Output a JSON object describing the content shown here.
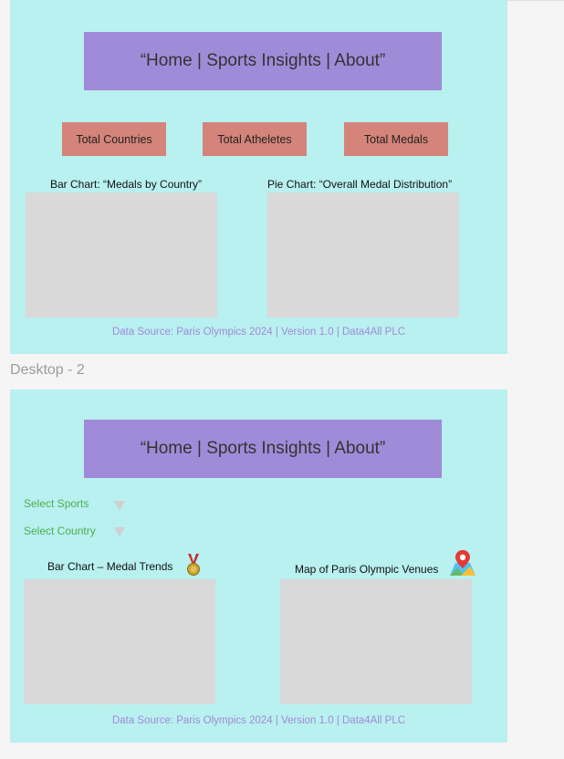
{
  "frame_label": "Desktop - 2",
  "desktop1": {
    "nav": "“Home | Sports Insights | About”",
    "cards": [
      "Total Countries",
      "Total Atheletes",
      "Total Medals"
    ],
    "bar_chart_title": "Bar Chart: “Medals by Country”",
    "pie_chart_title": "Pie Chart: “Overall Medal Distribution”",
    "footer": "Data Source: Paris Olympics 2024 | Version 1.0 | Data4All PLC"
  },
  "desktop2": {
    "nav": "“Home | Sports Insights | About”",
    "filters": {
      "sports": "Select Sports",
      "country": "Select Country"
    },
    "bar_chart_title": "Bar Chart – Medal Trends",
    "map_title": "Map of Paris Olympic Venues",
    "footer": "Data Source: Paris Olympics 2024 | Version 1.0 | Data4All PLC"
  },
  "colors": {
    "frame_bg": "#b9f0f0",
    "nav_bg": "#a08bd8",
    "card_bg": "#d4847a",
    "placeholder_bg": "#d9d9d9",
    "filter_text": "#4caf50"
  },
  "icons": [
    "medal-icon",
    "map-pin-icon"
  ]
}
